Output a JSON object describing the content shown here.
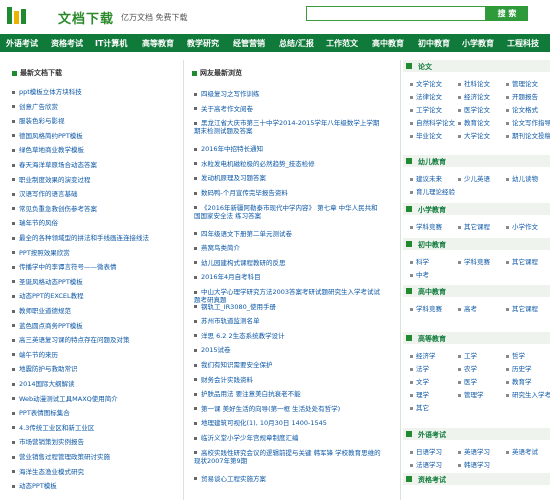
{
  "header": {
    "brand": "文档下载",
    "slogan": "亿万文档 免费下载",
    "search_button": "搜 索",
    "search_placeholder": ""
  },
  "nav": [
    "外语考试",
    "资格考试",
    "IT计算机",
    "高等教育",
    "教学研究",
    "经管营销",
    "总结/汇报",
    "工作范文",
    "高中教育",
    "初中教育",
    "小学教育",
    "工程科技"
  ],
  "left": {
    "title": "最新文档下载",
    "items": [
      "ppt模板立体方块科技",
      "创意广告欣赏",
      "服装色彩与影视",
      "德国风格简约PPT模板",
      "绿色草地商业教学模板",
      "春天海洋草原场合动态答案",
      "职业制度效果的演变过程",
      "汉语写作的语言基础",
      "常见负重急救创伤参考答案",
      "瑞年节的风俗",
      "最全的各种领域型的拼法和手线画连连接线法",
      "PPT按照效果欣赏",
      "传播学中的李谭言符号——微表情",
      "圣诞风格动态PPT模板",
      "动态PPT的EXCEL教程",
      "教师职业道德规范",
      "蓝色圆点商务PPT模板",
      "高三英语复习课的特点存在问题及对策",
      "端午节的来历",
      "地震防护与救助常识",
      "2014国际大纲解读",
      "Web动漫测试工具MAXQ使用简介",
      "PPT表情图标集合",
      "4.3传统工业区和新工业区",
      "市场营销策划实例报告",
      "营业销售过程管理政策研讨实施",
      "海洋生态渔业模式研究",
      "动态PPT模板"
    ]
  },
  "mid": {
    "title": "网友最新浏览",
    "items": [
      "四级复习之写作训练",
      "关于高考作文阅卷",
      "黑龙江省大庆市第三十中学2014-2015学年八年级数学上学期期末检测试题及答案",
      "2016年中招特长通知",
      "水粒发电机磁粒极的必然趋势_技态检修",
      "发动机原理及习题答案",
      "数码鸭-个月宣传完毕报告资料",
      "《2016年新疆阿勒泰市现代中学内容》 第七章 中华人民共和国国家安全法 练习答案",
      "四年级语文下册第二单元测试卷",
      "燕窝鸟类简介",
      "幼儿园建构式课程教研的反思",
      "2016年4月自考科目",
      "中山大学心理学研究方法2003答案考研试题研究生入学考试试题考研真题",
      "钢轨工_IR3080_使用手册",
      "苏州市轨道监测名单",
      "洋思 6.2 2生态系统教学设计",
      "2015试卷",
      "我们有知识需要安全保护",
      "财务会计实践资料",
      "护肤品用法 要注意美白抗衰老不能",
      "第一课 美好生活的向导(第一框 生活处处有哲学)",
      "地理建筑可视化(1), 10月30日 1400-1545",
      "临沂义堂小学少年宫规章制度汇编",
      "高校实践性研究会议的逻辑前提与关键 韩军锋 学校教育思维的现状2007年第9期",
      "贸易谈心工程实施方案"
    ]
  },
  "side": [
    {
      "title": "论文",
      "links": [
        "文学论文",
        "社科论文",
        "管理论文",
        "法律论文",
        "经济论文",
        "开题报告",
        "工学论文",
        "医学论文",
        "论文格式",
        "自然科学论文",
        "教育论文",
        "论文写作指导",
        "毕业论文",
        "大学论文",
        "期刊论文投稿"
      ]
    },
    {
      "title": "幼儿教育",
      "links": [
        "建议未来",
        "少儿英语",
        "幼儿读物",
        "育儿理论经验"
      ]
    },
    {
      "title": "小学教育",
      "links": [
        "学科竞赛",
        "其它课程",
        "小学作文"
      ]
    },
    {
      "title": "初中教育",
      "links": [
        "科学",
        "学科竞赛",
        "其它课程",
        "中考"
      ]
    },
    {
      "title": "高中教育",
      "links": [
        "学科竞赛",
        "高考",
        "其它课程"
      ]
    },
    {
      "title": "高等教育",
      "links": [
        "经济学",
        "工学",
        "哲学",
        "法学",
        "农学",
        "历史学",
        "文学",
        "医学",
        "教育学",
        "理学",
        "管理学",
        "研究生入学考试",
        "其它"
      ]
    },
    {
      "title": "外语考试",
      "links": [
        "日语学习",
        "英语学习",
        "英语考试",
        "法语学习",
        "韩语学习"
      ]
    },
    {
      "title": "资格考试",
      "links": []
    }
  ],
  "colors": {
    "nav": "#0f7a3a",
    "accent": "#2f9a3a",
    "link": "#0b57a6"
  }
}
